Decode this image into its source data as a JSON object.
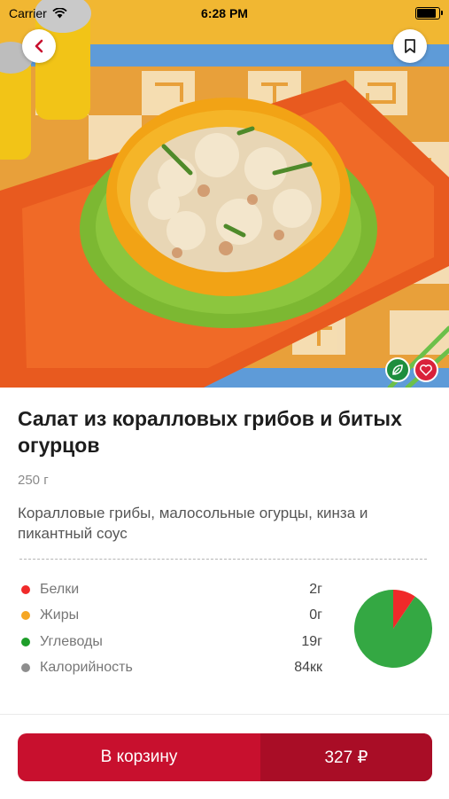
{
  "status_bar": {
    "carrier": "Carrier",
    "time": "6:28 PM"
  },
  "product": {
    "title": "Салат из коралловых грибов и битых огурцов",
    "weight": "250 г",
    "description": "Коралловые грибы, малосольные огурцы, кинза и пикантный соус"
  },
  "nutrition": [
    {
      "label": "Белки",
      "value": "2г",
      "color": "#f02a2a"
    },
    {
      "label": "Жиры",
      "value": "0г",
      "color": "#f5a623"
    },
    {
      "label": "Углеводы",
      "value": "19г",
      "color": "#1e9e2a"
    },
    {
      "label": "Калорийность",
      "value": "84кк",
      "color": "#8e8e8e"
    }
  ],
  "pie_chart": {
    "slices": [
      {
        "name": "Белки",
        "value": 2,
        "color": "#f02a2a"
      },
      {
        "name": "Жиры",
        "value": 0,
        "color": "#f5a623"
      },
      {
        "name": "Углеводы",
        "value": 19,
        "color": "#34a843"
      }
    ]
  },
  "cart": {
    "label": "В корзину",
    "price": "327 ₽"
  },
  "icons": {
    "back": "chevron-left-icon",
    "bookmark": "bookmark-icon",
    "vegan": "leaf-icon",
    "favorite": "heart-icon"
  },
  "colors": {
    "accent": "#c8102e",
    "accent_dark": "#a90d26"
  }
}
